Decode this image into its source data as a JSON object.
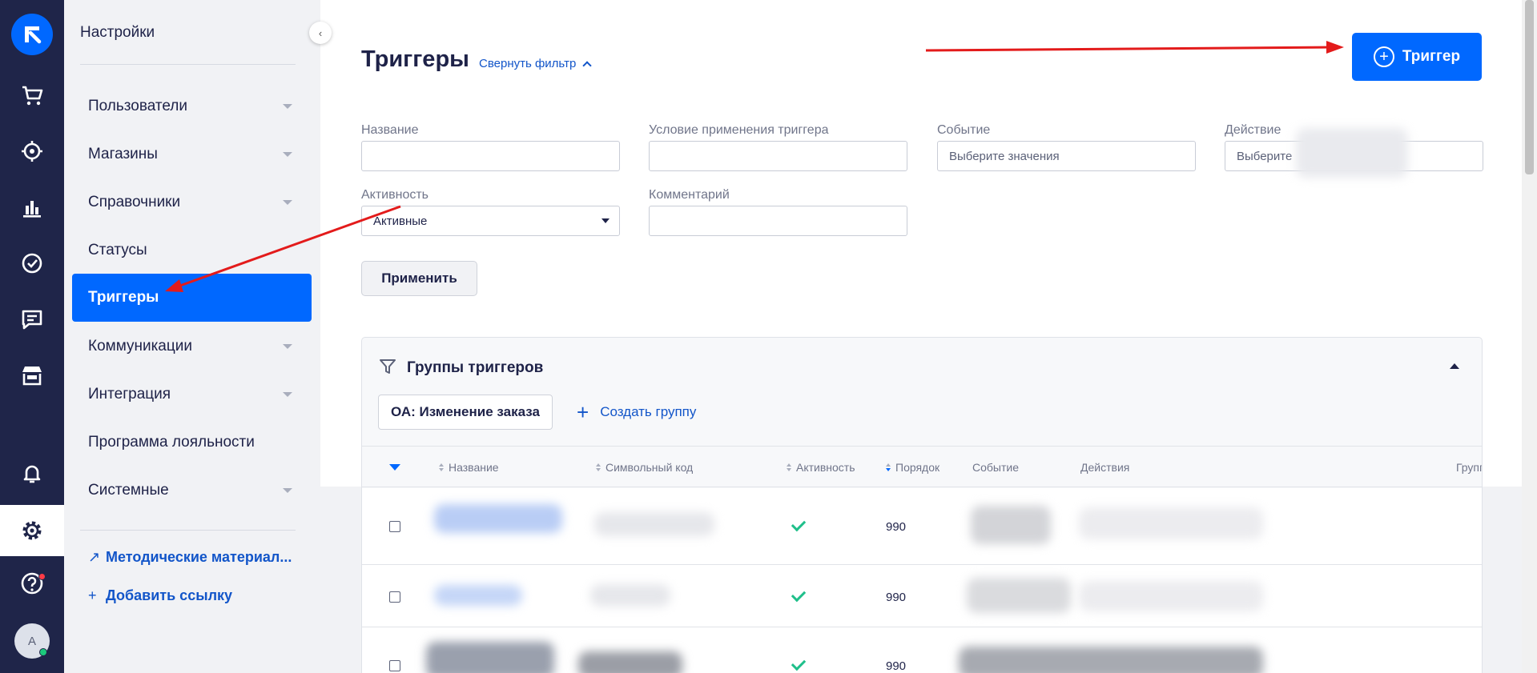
{
  "sidebar": {
    "title": "Настройки",
    "items": [
      {
        "label": "Пользователи",
        "has_caret": true
      },
      {
        "label": "Магазины",
        "has_caret": true
      },
      {
        "label": "Справочники",
        "has_caret": true
      },
      {
        "label": "Статусы",
        "has_caret": false
      },
      {
        "label": "Триггеры",
        "has_caret": false,
        "active": true
      },
      {
        "label": "Коммуникации",
        "has_caret": true
      },
      {
        "label": "Интеграция",
        "has_caret": true
      },
      {
        "label": "Программа лояльности",
        "has_caret": false
      },
      {
        "label": "Системные",
        "has_caret": true
      }
    ],
    "links": [
      {
        "icon": "arrow-up-right-icon",
        "label": "Методические материал..."
      },
      {
        "icon": "plus-icon",
        "label": "Добавить ссылку"
      }
    ]
  },
  "rail": {
    "icons": [
      "cart-icon",
      "target-icon",
      "analytics-icon",
      "check-circle-icon",
      "chat-icon",
      "store-icon",
      "bell-icon",
      "gear-icon",
      "help-icon"
    ],
    "avatar_initial": "A"
  },
  "header": {
    "title": "Триггеры",
    "collapse_filter": "Свернуть фильтр",
    "add_button": "Триггер"
  },
  "filters": {
    "name_label": "Название",
    "condition_label": "Условие применения триггера",
    "event_label": "Событие",
    "event_placeholder": "Выберите значения",
    "action_label": "Действие",
    "action_placeholder": "Выберите",
    "activity_label": "Активность",
    "activity_value": "Активные",
    "comment_label": "Комментарий",
    "apply_button": "Применить"
  },
  "groups": {
    "title": "Группы триггеров",
    "chip": "ОА: Изменение заказа",
    "create": "Создать группу"
  },
  "table": {
    "columns": [
      "Название",
      "Символьный код",
      "Активность",
      "Порядок",
      "Событие",
      "Действия",
      "Групп"
    ],
    "rows": [
      {
        "active": true,
        "order": "990"
      },
      {
        "active": true,
        "order": "990"
      },
      {
        "active": true,
        "order": "990"
      }
    ]
  },
  "colors": {
    "accent": "#0068ff",
    "rail_bg": "#1f2549",
    "sidebar_bg": "#f1f2f5",
    "success": "#1fbf8a",
    "annotation_arrow": "#e31b1b"
  }
}
